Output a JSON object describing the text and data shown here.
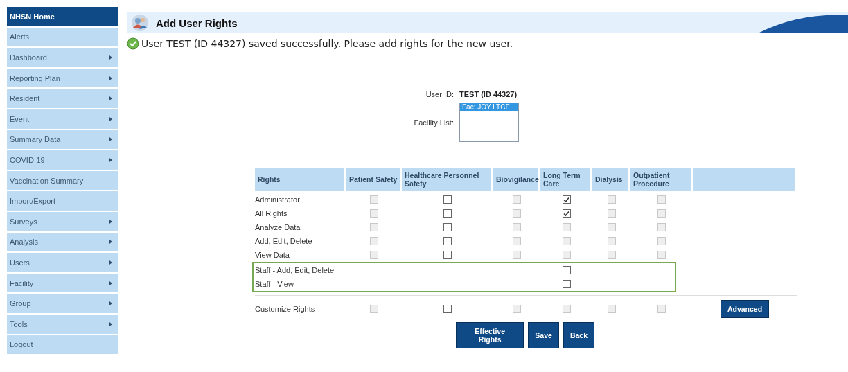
{
  "sidebar": {
    "items": [
      {
        "label": "NHSN Home",
        "selected": true,
        "submenu": false
      },
      {
        "label": "Alerts",
        "selected": false,
        "submenu": false
      },
      {
        "label": "Dashboard",
        "selected": false,
        "submenu": true
      },
      {
        "label": "Reporting Plan",
        "selected": false,
        "submenu": true
      },
      {
        "label": "Resident",
        "selected": false,
        "submenu": true
      },
      {
        "label": "Event",
        "selected": false,
        "submenu": true
      },
      {
        "label": "Summary Data",
        "selected": false,
        "submenu": true
      },
      {
        "label": "COVID-19",
        "selected": false,
        "submenu": true
      },
      {
        "label": "Vaccination Summary",
        "selected": false,
        "submenu": false
      },
      {
        "label": "Import/Export",
        "selected": false,
        "submenu": false
      },
      {
        "label": "Surveys",
        "selected": false,
        "submenu": true
      },
      {
        "label": "Analysis",
        "selected": false,
        "submenu": true
      },
      {
        "label": "Users",
        "selected": false,
        "submenu": true
      },
      {
        "label": "Facility",
        "selected": false,
        "submenu": true
      },
      {
        "label": "Group",
        "selected": false,
        "submenu": true
      },
      {
        "label": "Tools",
        "selected": false,
        "submenu": true
      },
      {
        "label": "Logout",
        "selected": false,
        "submenu": false
      }
    ]
  },
  "page": {
    "title": "Add User Rights",
    "message": "User TEST (ID 44327) saved successfully. Please add rights for the new user."
  },
  "form": {
    "user_id_label": "User ID:",
    "user_id": "TEST (ID 44327)",
    "facility_label": "Facility List:",
    "facilities": [
      {
        "label": "Fac: JOY LTCF",
        "selected": true
      }
    ]
  },
  "table": {
    "columns": [
      "Rights",
      "Patient Safety",
      "Healthcare Personnel Safety",
      "Biovigilance",
      "Long Term Care",
      "Dialysis",
      "Outpatient Procedure"
    ],
    "rows": [
      {
        "label": "Administrator",
        "highlighted": false,
        "cells": [
          {
            "checked": false,
            "disabled": true
          },
          {
            "checked": false,
            "disabled": false
          },
          {
            "checked": false,
            "disabled": true
          },
          {
            "checked": true,
            "disabled": false
          },
          {
            "checked": false,
            "disabled": true
          },
          {
            "checked": false,
            "disabled": true
          }
        ]
      },
      {
        "label": "All Rights",
        "highlighted": false,
        "cells": [
          {
            "checked": false,
            "disabled": true
          },
          {
            "checked": false,
            "disabled": false
          },
          {
            "checked": false,
            "disabled": true
          },
          {
            "checked": true,
            "disabled": false
          },
          {
            "checked": false,
            "disabled": true
          },
          {
            "checked": false,
            "disabled": true
          }
        ]
      },
      {
        "label": "Analyze Data",
        "highlighted": false,
        "cells": [
          {
            "checked": false,
            "disabled": true
          },
          {
            "checked": false,
            "disabled": false
          },
          {
            "checked": false,
            "disabled": true
          },
          {
            "checked": false,
            "disabled": true
          },
          {
            "checked": false,
            "disabled": true
          },
          {
            "checked": false,
            "disabled": true
          }
        ]
      },
      {
        "label": "Add, Edit, Delete",
        "highlighted": false,
        "cells": [
          {
            "checked": false,
            "disabled": true
          },
          {
            "checked": false,
            "disabled": false
          },
          {
            "checked": false,
            "disabled": true
          },
          {
            "checked": false,
            "disabled": true
          },
          {
            "checked": false,
            "disabled": true
          },
          {
            "checked": false,
            "disabled": true
          }
        ]
      },
      {
        "label": "View Data",
        "highlighted": false,
        "cells": [
          {
            "checked": false,
            "disabled": true
          },
          {
            "checked": false,
            "disabled": false
          },
          {
            "checked": false,
            "disabled": true
          },
          {
            "checked": false,
            "disabled": true
          },
          {
            "checked": false,
            "disabled": true
          },
          {
            "checked": false,
            "disabled": true
          }
        ]
      },
      {
        "label": "Staff - Add, Edit, Delete",
        "highlighted": true,
        "cells": [
          null,
          null,
          null,
          {
            "checked": false,
            "disabled": false
          },
          null,
          null
        ]
      },
      {
        "label": "Staff - View",
        "highlighted": true,
        "cells": [
          null,
          null,
          null,
          {
            "checked": false,
            "disabled": false
          },
          null,
          null
        ]
      }
    ],
    "footer_row": {
      "label": "Customize Rights",
      "cells": [
        {
          "checked": false,
          "disabled": true
        },
        {
          "checked": false,
          "disabled": false
        },
        {
          "checked": false,
          "disabled": true
        },
        {
          "checked": false,
          "disabled": true
        },
        {
          "checked": false,
          "disabled": true
        },
        {
          "checked": false,
          "disabled": true
        }
      ],
      "button": "Advanced"
    }
  },
  "buttons": [
    "Effective Rights",
    "Save",
    "Back"
  ]
}
